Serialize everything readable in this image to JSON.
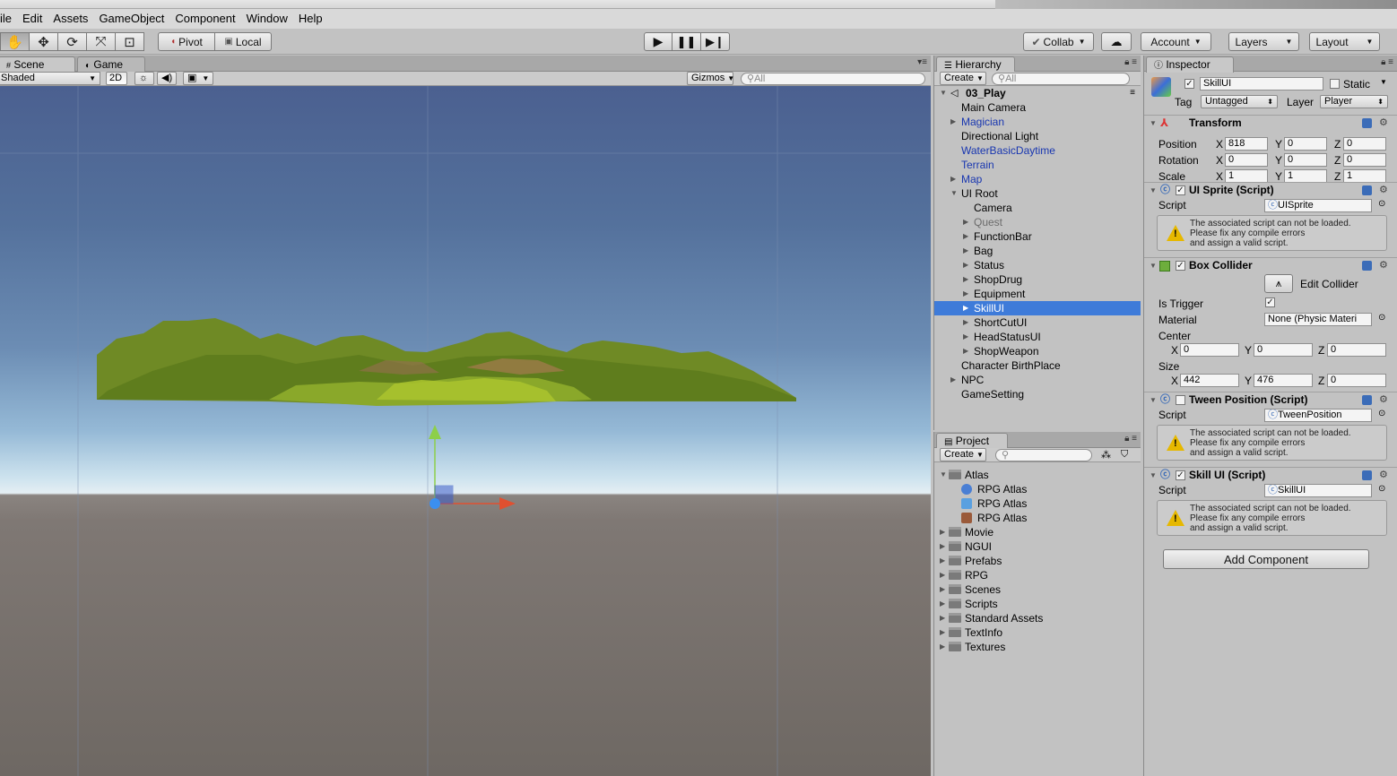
{
  "menu": [
    "ile",
    "Edit",
    "Assets",
    "GameObject",
    "Component",
    "Window",
    "Help"
  ],
  "toolbar": {
    "pivot": "Pivot",
    "local": "Local",
    "collab": "Collab",
    "account": "Account",
    "layers": "Layers",
    "layout": "Layout"
  },
  "scene": {
    "tab_scene": "Scene",
    "tab_game": "Game",
    "shading": "Shaded",
    "mode_2d": "2D",
    "gizmos": "Gizmos",
    "search_placeholder": "All"
  },
  "hierarchy": {
    "tab": "Hierarchy",
    "create": "Create",
    "search_placeholder": "All",
    "scene_name": "03_Play",
    "items": [
      {
        "label": "Main Camera",
        "style": "normal"
      },
      {
        "label": "Magician",
        "style": "blue"
      },
      {
        "label": "Directional Light",
        "style": "normal"
      },
      {
        "label": "WaterBasicDaytime",
        "style": "blue"
      },
      {
        "label": "Terrain",
        "style": "blue"
      },
      {
        "label": "Map",
        "style": "blue"
      },
      {
        "label": "UI Root",
        "style": "normal"
      },
      {
        "label": "Camera",
        "style": "normal"
      },
      {
        "label": "Quest",
        "style": "grey"
      },
      {
        "label": "FunctionBar",
        "style": "normal"
      },
      {
        "label": "Bag",
        "style": "normal"
      },
      {
        "label": "Status",
        "style": "normal"
      },
      {
        "label": "ShopDrug",
        "style": "normal"
      },
      {
        "label": "Equipment",
        "style": "normal"
      },
      {
        "label": "SkillUI",
        "style": "selected"
      },
      {
        "label": "ShortCutUI",
        "style": "normal"
      },
      {
        "label": "HeadStatusUI",
        "style": "normal"
      },
      {
        "label": "ShopWeapon",
        "style": "normal"
      },
      {
        "label": "Character BirthPlace",
        "style": "normal"
      },
      {
        "label": "NPC",
        "style": "normal"
      },
      {
        "label": "GameSetting",
        "style": "normal"
      }
    ]
  },
  "project": {
    "tab": "Project",
    "create": "Create",
    "items": [
      "Atlas",
      "RPG Atlas",
      "RPG Atlas",
      "RPG Atlas",
      "Movie",
      "NGUI",
      "Prefabs",
      "RPG",
      "Scenes",
      "Scripts",
      "Standard Assets",
      "TextInfo",
      "Textures"
    ]
  },
  "inspector": {
    "tab": "Inspector",
    "object_name": "SkillUI",
    "static_label": "Static",
    "tag_label": "Tag",
    "tag_value": "Untagged",
    "layer_label": "Layer",
    "layer_value": "Player",
    "transform": {
      "title": "Transform",
      "position_label": "Position",
      "rotation_label": "Rotation",
      "scale_label": "Scale",
      "position": {
        "x": "818",
        "y": "0",
        "z": "0"
      },
      "rotation": {
        "x": "0",
        "y": "0",
        "z": "0"
      },
      "scale": {
        "x": "1",
        "y": "1",
        "z": "1"
      }
    },
    "axis": {
      "x": "X",
      "y": "Y",
      "z": "Z"
    },
    "script_label": "Script",
    "warning": "The associated script can not be loaded.\nPlease fix any compile errors\nand assign a valid script.",
    "ui_sprite": {
      "title": "UI Sprite (Script)",
      "script": "UISprite"
    },
    "box_collider": {
      "title": "Box Collider",
      "edit_collider": "Edit Collider",
      "is_trigger": "Is Trigger",
      "material_label": "Material",
      "material_value": "None (Physic Materi",
      "center_label": "Center",
      "size_label": "Size",
      "center": {
        "x": "0",
        "y": "0",
        "z": "0"
      },
      "size": {
        "x": "442",
        "y": "476",
        "z": "0"
      }
    },
    "tween_position": {
      "title": "Tween Position (Script)",
      "script": "TweenPosition"
    },
    "skill_ui": {
      "title": "Skill UI (Script)",
      "script": "SkillUI"
    },
    "add_component": "Add Component"
  }
}
